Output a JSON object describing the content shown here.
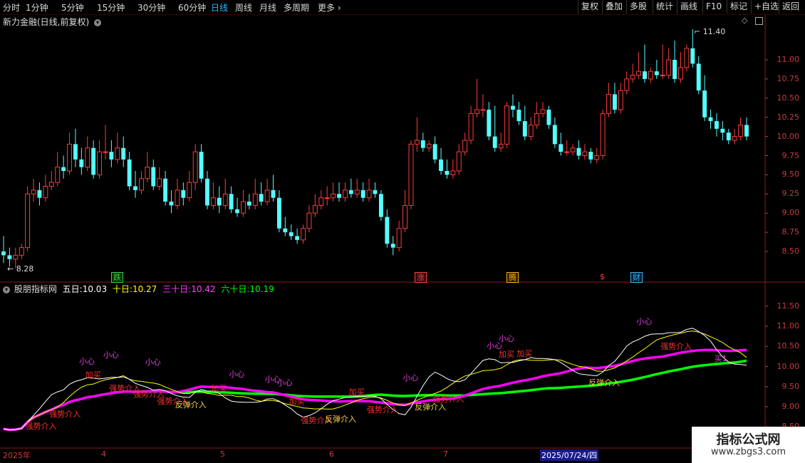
{
  "periods": [
    "分时",
    "1分钟",
    "5分钟",
    "15分钟",
    "30分钟",
    "60分钟",
    "日线",
    "周线",
    "月线",
    "多周期",
    "更多"
  ],
  "active_period": "日线",
  "toolbar_right": [
    "复权",
    "叠加",
    "多股",
    "统计",
    "画线",
    "F10",
    "标记",
    "+自选",
    "返回"
  ],
  "stock_title": "新力金融(日线,前复权)",
  "high_marker": "11.40",
  "low_marker": "8.28",
  "price_axis": [
    "11.00",
    "10.75",
    "10.50",
    "10.25",
    "10.00",
    "9.75",
    "9.50",
    "9.25",
    "9.00",
    "8.75",
    "8.50"
  ],
  "event_tags": [
    {
      "label": "跌",
      "color": "#3ad13a"
    },
    {
      "label": "涨",
      "color": "#ff4040"
    },
    {
      "label": "腾",
      "color": "#ffb000"
    },
    {
      "label": "$",
      "color": "#ff4040"
    },
    {
      "label": "财",
      "color": "#35b7ff"
    }
  ],
  "indicator": {
    "name": "股朋指标网",
    "ma5_label": "五日:",
    "ma5_value": "10.03",
    "ma10_label": "十日:",
    "ma10_value": "10.27",
    "ma30_label": "三十日:",
    "ma30_value": "10.42",
    "ma60_label": "六十日:",
    "ma60_value": "10.19"
  },
  "indicator_axis": [
    "11.50",
    "11.00",
    "10.50",
    "10.00",
    "9.50",
    "9.00",
    "8.50"
  ],
  "date_labels": [
    "2025年",
    "4",
    "5",
    "6",
    "7",
    "2025/07/24/四"
  ],
  "signals": [
    {
      "t": "强势介入",
      "c": "#ff3030"
    },
    {
      "t": "强势介入",
      "c": "#ff3030"
    },
    {
      "t": "强势介入",
      "c": "#ff3030"
    },
    {
      "t": "强势介入",
      "c": "#ff3030"
    },
    {
      "t": "强势介入",
      "c": "#ff3030"
    },
    {
      "t": "加买",
      "c": "#ff3030"
    },
    {
      "t": "小心",
      "c": "#e040e0"
    },
    {
      "t": "小心",
      "c": "#e040e0"
    },
    {
      "t": "小心",
      "c": "#e040e0"
    },
    {
      "t": "反弹介入",
      "c": "#ffd24a"
    },
    {
      "t": "加买",
      "c": "#ff3030"
    },
    {
      "t": "小心",
      "c": "#e040e0"
    },
    {
      "t": "小心",
      "c": "#e040e0"
    },
    {
      "t": "强势介入",
      "c": "#ff3030"
    },
    {
      "t": "加买",
      "c": "#ff3030"
    },
    {
      "t": "小心",
      "c": "#e040e0"
    },
    {
      "t": "反弹介入",
      "c": "#ffd24a"
    },
    {
      "t": "加买",
      "c": "#ff3030"
    },
    {
      "t": "强势介入",
      "c": "#ff3030"
    },
    {
      "t": "小心",
      "c": "#e040e0"
    },
    {
      "t": "反弹介入",
      "c": "#ffd24a"
    },
    {
      "t": "小心",
      "c": "#e040e0"
    },
    {
      "t": "加买",
      "c": "#ff3030"
    },
    {
      "t": "强势介入",
      "c": "#ff3030"
    },
    {
      "t": "小心",
      "c": "#e040e0"
    },
    {
      "t": "加买",
      "c": "#ff3030"
    },
    {
      "t": "反弹介入",
      "c": "#ffd24a"
    },
    {
      "t": "小心",
      "c": "#e040e0"
    },
    {
      "t": "强势介入",
      "c": "#ff3030"
    },
    {
      "t": "买1",
      "c": "#e040e0"
    }
  ],
  "watermark": {
    "title": "指标公式网",
    "url": "www.zbgs3.com"
  },
  "colors": {
    "up": "#ff3c3c",
    "down": "#54ffff",
    "ma5": "#ffffff",
    "ma10": "#ffff00",
    "ma30": "#ff00ff",
    "ma60": "#00ff00",
    "axis": "#c83c3c"
  },
  "chart_data": {
    "type": "candlestick",
    "open": [
      8.5,
      8.45,
      8.4,
      8.45,
      8.55,
      9.25,
      9.3,
      9.2,
      9.35,
      9.4,
      9.6,
      9.55,
      9.9,
      9.7,
      9.6,
      9.85,
      9.5,
      9.8,
      9.8,
      9.7,
      9.85,
      9.7,
      9.35,
      9.3,
      9.45,
      9.6,
      9.35,
      9.45,
      9.15,
      9.1,
      9.3,
      9.2,
      9.4,
      9.8,
      9.45,
      9.1,
      9.2,
      9.1,
      9.25,
      9.05,
      9.0,
      9.15,
      9.1,
      9.25,
      9.15,
      9.3,
      9.2,
      8.8,
      8.75,
      8.7,
      8.65,
      8.8,
      9.0,
      9.1,
      9.2,
      9.2,
      9.25,
      9.2,
      9.3,
      9.25,
      9.3,
      9.2,
      9.3,
      9.25,
      8.95,
      8.6,
      8.55,
      8.8,
      9.1,
      9.9,
      9.95,
      9.85,
      9.9,
      9.7,
      9.55,
      9.5,
      9.55,
      9.8,
      9.95,
      10.3,
      10.35,
      10.35,
      10.0,
      9.85,
      9.9,
      10.4,
      10.35,
      10.2,
      10.0,
      10.15,
      10.3,
      10.35,
      10.15,
      9.9,
      9.8,
      9.8,
      9.85,
      9.75,
      9.8,
      9.7,
      9.75,
      10.3,
      10.55,
      10.35,
      10.6,
      10.75,
      10.8,
      10.85,
      10.75,
      10.85,
      10.8,
      10.8,
      11.0,
      10.75,
      10.9,
      11.15,
      10.95,
      10.6,
      10.25,
      10.2,
      10.1,
      10.05,
      9.95,
      10.0,
      10.15
    ],
    "close": [
      8.45,
      8.4,
      8.45,
      8.55,
      9.25,
      9.3,
      9.2,
      9.35,
      9.4,
      9.6,
      9.55,
      9.9,
      9.7,
      9.6,
      9.85,
      9.5,
      9.8,
      9.8,
      9.7,
      9.85,
      9.7,
      9.35,
      9.3,
      9.45,
      9.6,
      9.35,
      9.45,
      9.15,
      9.1,
      9.3,
      9.2,
      9.4,
      9.8,
      9.45,
      9.1,
      9.2,
      9.1,
      9.25,
      9.05,
      9.0,
      9.15,
      9.1,
      9.25,
      9.15,
      9.3,
      9.2,
      8.8,
      8.75,
      8.7,
      8.65,
      8.8,
      9.0,
      9.1,
      9.2,
      9.2,
      9.25,
      9.2,
      9.3,
      9.25,
      9.3,
      9.2,
      9.3,
      9.25,
      8.95,
      8.6,
      8.55,
      8.8,
      9.1,
      9.9,
      9.95,
      9.85,
      9.9,
      9.7,
      9.55,
      9.5,
      9.55,
      9.8,
      9.95,
      10.3,
      10.35,
      10.35,
      10.0,
      9.85,
      9.9,
      10.4,
      10.35,
      10.2,
      10.0,
      10.15,
      10.3,
      10.35,
      10.15,
      9.9,
      9.8,
      9.8,
      9.85,
      9.75,
      9.8,
      9.7,
      9.75,
      10.3,
      10.55,
      10.35,
      10.6,
      10.75,
      10.8,
      10.85,
      10.75,
      10.85,
      10.8,
      10.8,
      11.0,
      10.75,
      10.9,
      11.15,
      10.95,
      10.6,
      10.25,
      10.2,
      10.1,
      10.05,
      9.95,
      10.0,
      10.15,
      10.0
    ],
    "high": [
      8.7,
      8.55,
      8.55,
      8.6,
      9.35,
      9.45,
      9.4,
      9.5,
      9.55,
      9.8,
      9.75,
      10.05,
      10.1,
      9.85,
      10.0,
      9.95,
      9.95,
      10.15,
      9.95,
      10.05,
      10.0,
      9.8,
      9.55,
      9.55,
      9.8,
      9.7,
      9.6,
      9.55,
      9.3,
      9.45,
      9.4,
      9.55,
      9.9,
      9.9,
      9.55,
      9.4,
      9.35,
      9.45,
      9.35,
      9.2,
      9.3,
      9.25,
      9.45,
      9.4,
      9.45,
      9.5,
      9.3,
      8.95,
      8.85,
      8.8,
      8.85,
      9.1,
      9.25,
      9.3,
      9.35,
      9.4,
      9.4,
      9.4,
      9.45,
      9.45,
      9.4,
      9.45,
      9.4,
      9.3,
      9.05,
      8.7,
      8.9,
      9.3,
      9.95,
      10.25,
      10.05,
      9.95,
      10.0,
      9.85,
      9.7,
      9.7,
      9.9,
      10.05,
      10.4,
      10.75,
      10.55,
      10.45,
      10.4,
      10.05,
      10.45,
      10.55,
      10.45,
      10.4,
      10.25,
      10.45,
      10.45,
      10.4,
      10.25,
      10.05,
      9.95,
      9.9,
      9.95,
      9.9,
      9.85,
      9.85,
      10.35,
      10.7,
      10.7,
      10.7,
      10.85,
      10.95,
      11.1,
      11.2,
      10.9,
      11.0,
      11.2,
      11.15,
      11.25,
      11.1,
      11.2,
      11.4,
      11.05,
      10.8,
      10.35,
      10.3,
      10.2,
      10.1,
      10.1,
      10.25,
      10.25
    ],
    "low": [
      8.35,
      8.3,
      8.28,
      8.4,
      8.5,
      9.15,
      9.1,
      9.15,
      9.3,
      9.35,
      9.45,
      9.5,
      9.6,
      9.5,
      9.55,
      9.45,
      9.45,
      9.7,
      9.6,
      9.65,
      9.6,
      9.3,
      9.2,
      9.25,
      9.4,
      9.3,
      9.3,
      9.1,
      9.0,
      9.05,
      9.1,
      9.15,
      9.3,
      9.4,
      9.05,
      9.05,
      9.0,
      9.05,
      9.0,
      8.95,
      8.95,
      9.05,
      9.05,
      9.1,
      9.1,
      9.15,
      8.75,
      8.7,
      8.65,
      8.6,
      8.6,
      8.75,
      8.95,
      9.05,
      9.1,
      9.15,
      9.15,
      9.15,
      9.2,
      9.2,
      9.15,
      9.15,
      9.2,
      8.9,
      8.55,
      8.45,
      8.5,
      8.75,
      9.05,
      9.8,
      9.8,
      9.8,
      9.65,
      9.5,
      9.45,
      9.45,
      9.5,
      9.75,
      9.9,
      10.25,
      10.25,
      9.95,
      9.8,
      9.8,
      9.85,
      10.25,
      10.15,
      9.95,
      9.95,
      10.1,
      10.25,
      10.1,
      9.85,
      9.75,
      9.75,
      9.75,
      9.7,
      9.7,
      9.65,
      9.65,
      9.7,
      10.25,
      10.3,
      10.3,
      10.55,
      10.7,
      10.75,
      10.7,
      10.7,
      10.75,
      10.75,
      10.75,
      10.7,
      10.7,
      10.85,
      10.9,
      10.55,
      10.2,
      10.1,
      10.0,
      9.95,
      9.9,
      9.9,
      9.95,
      9.95
    ]
  }
}
